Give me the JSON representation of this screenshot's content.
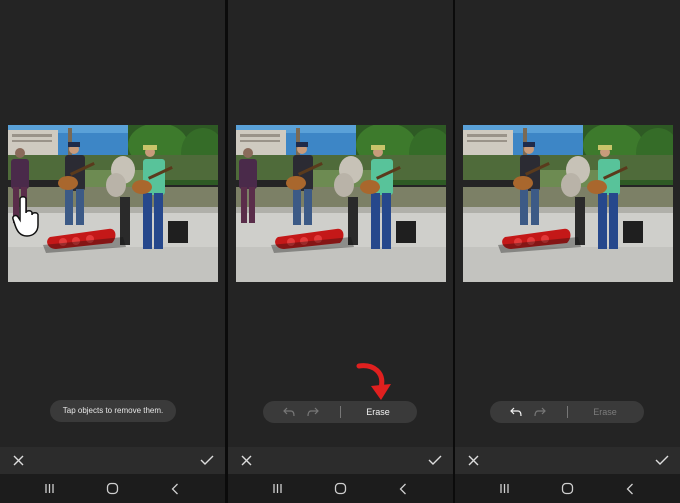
{
  "panels": [
    {
      "id": "step-1",
      "hint_text": "Tap objects to remove them.",
      "icons": {
        "close": "close-icon",
        "confirm": "check-icon"
      }
    },
    {
      "id": "step-2",
      "erase_label": "Erase",
      "undo_enabled": false,
      "redo_enabled": false,
      "erase_enabled": true,
      "annotation_arrow_color": "#e0201f"
    },
    {
      "id": "step-3",
      "erase_label": "Erase",
      "undo_enabled": true,
      "redo_enabled": false,
      "erase_enabled": false
    }
  ],
  "navigation": {
    "icons": [
      "recents-icon",
      "home-icon",
      "back-icon"
    ]
  },
  "colors": {
    "background": "#242424",
    "pill": "#3a3a3a",
    "text": "#e6e6e6",
    "accent_arrow": "#e0201f"
  }
}
